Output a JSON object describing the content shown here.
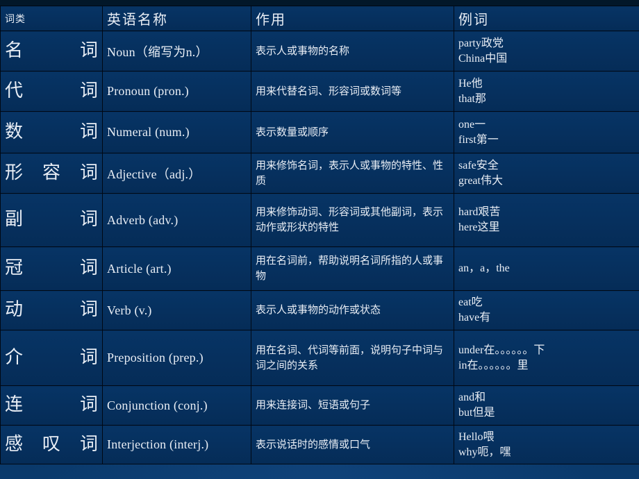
{
  "slide": {
    "background_color": "#052a51",
    "cell_color": "#06305e",
    "border_color": "#000814",
    "text_color": "#e9eef5"
  },
  "table": {
    "headers": {
      "type": "词类",
      "english_name": "英语名称",
      "role": "作用",
      "example": "例词"
    },
    "rows": [
      {
        "type": "名　　词",
        "english_name": "Noun（缩写为n.）",
        "role": "表示人或事物的名称",
        "examples": [
          "party政党",
          "China中国"
        ]
      },
      {
        "type": "代　　词",
        "english_name": "Pronoun (pron.)",
        "role": "用来代替名词、形容词或数词等",
        "examples": [
          "He他",
          "that那"
        ]
      },
      {
        "type": "数　　词",
        "english_name": "Numeral (num.)",
        "role": "表示数量或顺序",
        "examples": [
          "one一",
          "first第一"
        ]
      },
      {
        "type": "形　容　词",
        "english_name": "Adjective（adj.）",
        "role": "用来修饰名词，表示人或事物的特性、性质",
        "examples": [
          "safe安全",
          "great伟大"
        ]
      },
      {
        "type": "副　　词",
        "english_name": "Adverb (adv.)",
        "role": "用来修饰动词、形容词或其他副词，表示动作或形状的特性",
        "examples": [
          "hard艰苦",
          "here这里"
        ]
      },
      {
        "type": "冠　　词",
        "english_name": "Article (art.)",
        "role": "用在名词前，帮助说明名词所指的人或事物",
        "examples": [
          "an，a，the"
        ]
      },
      {
        "type": "动　　词",
        "english_name": "Verb (v.)",
        "role": "表示人或事物的动作或状态",
        "examples": [
          "eat吃",
          "have有"
        ]
      },
      {
        "type": "介　　词",
        "english_name": "Preposition (prep.)",
        "role": "用在名词、代词等前面，说明句子中词与词之间的关系",
        "examples": [
          "under在。。。。。。下",
          "in在。。。。。。里"
        ]
      },
      {
        "type": "连　　词",
        "english_name": "Conjunction (conj.)",
        "role": "用来连接词、短语或句子",
        "examples": [
          "and和",
          "but但是"
        ]
      },
      {
        "type": "感　叹　词",
        "english_name": "Interjection (interj.)",
        "role": "表示说话时的感情或口气",
        "examples": [
          "Hello喂",
          "why呃，嘿"
        ]
      }
    ]
  }
}
